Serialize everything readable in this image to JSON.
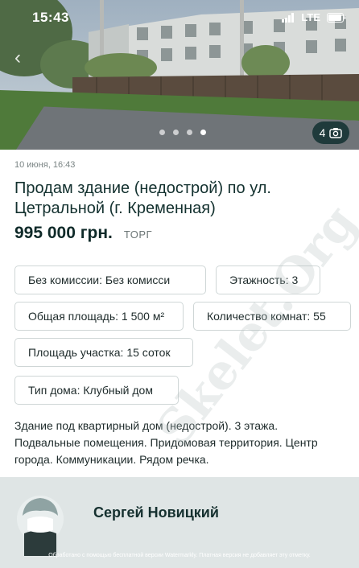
{
  "status_bar": {
    "time": "15:43",
    "network": "LTE"
  },
  "gallery": {
    "dots": 4,
    "active_dot": 4,
    "photo_count": "4"
  },
  "listing": {
    "date": "10 июня, 16:43",
    "title": "Продам здание (недострой) по ул. Цетральной (г. Кременная)",
    "price": "995 000 грн.",
    "negotiable": "ТОРГ",
    "params": [
      "Без комиссии: Без комисси",
      "Этажность: 3",
      "Общая площадь: 1 500 м²",
      "Количество комнат: 55",
      "Площадь участка: 15 соток",
      "Тип дома: Клубный дом"
    ],
    "description": "Здание под квартирный дом (недострой). 3 этажа. Подвальные помещения. Придомовая территория. Центр города. Коммуникации. Рядом речка."
  },
  "seller": {
    "name": "Сергей Новицкий"
  },
  "watermark": "Skelet.Org",
  "footer_note": "Обработано с помощью бесплатной версии Watermarkly. Платная версия не добавляет эту отметку.",
  "icons": {
    "camera": "camera-icon",
    "back": "chevron-left-icon",
    "signal": "signal-icon",
    "wifi": "wifi-icon",
    "battery": "battery-icon"
  }
}
